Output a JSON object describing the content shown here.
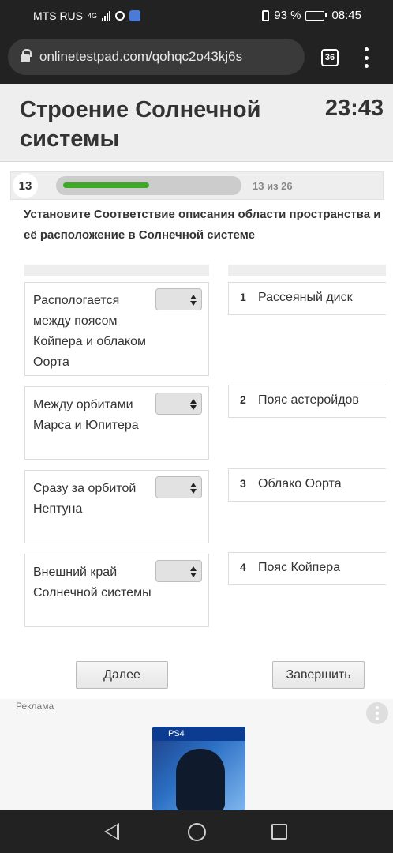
{
  "status_bar": {
    "carrier": "MTS RUS",
    "network": "4G",
    "battery": "93 %",
    "battery_level": 0.93,
    "time": "08:45"
  },
  "browser": {
    "url": "onlinetestpad.com/qohqc2o43kj6s",
    "tab_count": "36"
  },
  "header": {
    "title": "Строение Солнечной системы",
    "timer": "23:43"
  },
  "progress": {
    "question_number": "13",
    "count_text": "13 из 26",
    "fraction": 0.5
  },
  "question": "Установите Соответствие описания области пространства и её расположение в Солнечной системе",
  "left_items": [
    {
      "text": "Распологается между поясом Койпера и облаком Оорта",
      "selected": ""
    },
    {
      "text": "Между орбитами Марса и Юпитера",
      "selected": ""
    },
    {
      "text": "Сразу за орбитой Нептуна",
      "selected": ""
    },
    {
      "text": "Внешний край Солнечной системы",
      "selected": ""
    }
  ],
  "right_items": [
    {
      "num": "1",
      "text": "Рассеяный диск"
    },
    {
      "num": "2",
      "text": "Пояс астеройдов"
    },
    {
      "num": "3",
      "text": "Облако Оорта"
    },
    {
      "num": "4",
      "text": "Пояс Койпера"
    }
  ],
  "buttons": {
    "next": "Далее",
    "finish": "Завершить"
  },
  "ad": {
    "label": "Реклама",
    "ps_badge": "PS4"
  },
  "icons": {
    "lock": "lock-icon",
    "menu": "more-vert-icon",
    "back": "back-triangle-icon",
    "home": "home-circle-icon",
    "recent": "recent-square-icon"
  },
  "colors": {
    "progress_fill": "#3ea924",
    "header_bg": "#eeeeee"
  }
}
